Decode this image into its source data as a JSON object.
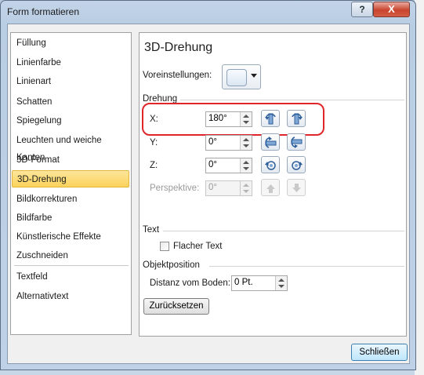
{
  "window": {
    "title": "Form formatieren",
    "help_label": "?",
    "close_label": "X"
  },
  "nav": {
    "items": [
      {
        "label": "Füllung"
      },
      {
        "label": "Linienfarbe"
      },
      {
        "label": "Linienart"
      },
      {
        "label": "Schatten"
      },
      {
        "label": "Spiegelung"
      },
      {
        "label": "Leuchten und weiche Kanten"
      },
      {
        "label": "3D-Format"
      },
      {
        "label": "3D-Drehung",
        "selected": true
      },
      {
        "label": "Bildkorrekturen"
      },
      {
        "label": "Bildfarbe"
      },
      {
        "label": "Künstlerische Effekte"
      },
      {
        "label": "Zuschneiden"
      },
      {
        "label": "Textfeld"
      },
      {
        "label": "Alternativtext"
      }
    ]
  },
  "panel": {
    "title": "3D-Drehung",
    "presets_label": "Voreinstellungen:",
    "rotation_section": "Drehung",
    "x_label": "X:",
    "x_value": "180°",
    "y_label": "Y:",
    "y_value": "0°",
    "z_label": "Z:",
    "z_value": "0°",
    "perspective_label": "Perspektive:",
    "perspective_value": "0°",
    "text_section": "Text",
    "flat_text_label": "Flacher Text",
    "flat_text_checked": false,
    "position_section": "Objektposition",
    "distance_label": "Distanz vom Boden:",
    "distance_value": "0 Pt.",
    "reset_label": "Zurücksetzen"
  },
  "footer": {
    "close_label": "Schließen"
  },
  "colors": {
    "selected_bg": "#fbd35c",
    "highlight": "#e0262a"
  }
}
